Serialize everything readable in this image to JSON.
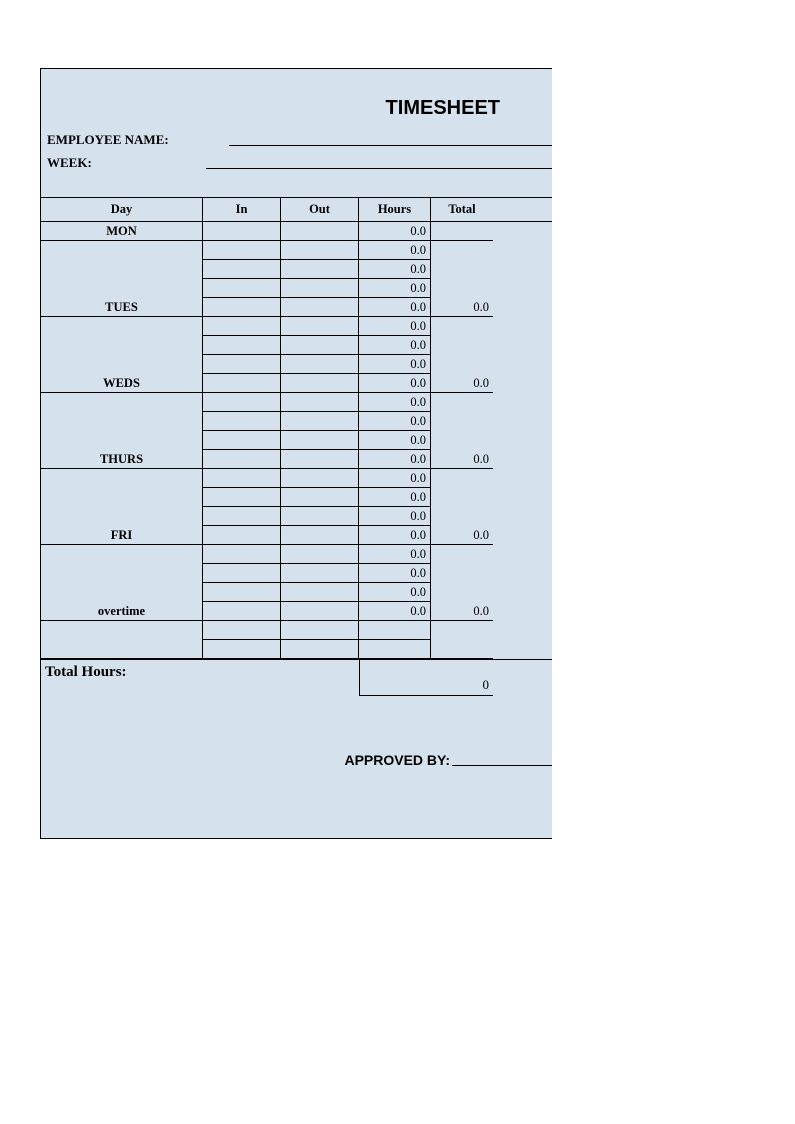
{
  "title": "TIMESHEET",
  "labels": {
    "employee_name": "EMPLOYEE NAME:",
    "week": "WEEK:",
    "approved_by": "APPROVED BY:",
    "total_hours": "Total Hours:"
  },
  "columns": {
    "day": "Day",
    "in": "In",
    "out": "Out",
    "hours": "Hours",
    "total": "Total"
  },
  "rows": [
    {
      "day": "MON",
      "in": "",
      "out": "",
      "hours": "0.0",
      "total": "",
      "day_border": true,
      "block_end": true
    },
    {
      "day": "",
      "in": "",
      "out": "",
      "hours": "0.0",
      "total": "",
      "day_border": false,
      "block_end": false
    },
    {
      "day": "",
      "in": "",
      "out": "",
      "hours": "0.0",
      "total": "",
      "day_border": false,
      "block_end": false
    },
    {
      "day": "",
      "in": "",
      "out": "",
      "hours": "0.0",
      "total": "",
      "day_border": false,
      "block_end": false
    },
    {
      "day": "TUES",
      "in": "",
      "out": "",
      "hours": "0.0",
      "total": "0.0",
      "day_border": true,
      "block_end": true
    },
    {
      "day": "",
      "in": "",
      "out": "",
      "hours": "0.0",
      "total": "",
      "day_border": false,
      "block_end": false
    },
    {
      "day": "",
      "in": "",
      "out": "",
      "hours": "0.0",
      "total": "",
      "day_border": false,
      "block_end": false
    },
    {
      "day": "",
      "in": "",
      "out": "",
      "hours": "0.0",
      "total": "",
      "day_border": false,
      "block_end": false
    },
    {
      "day": "WEDS",
      "in": "",
      "out": "",
      "hours": "0.0",
      "total": "0.0",
      "day_border": true,
      "block_end": true
    },
    {
      "day": "",
      "in": "",
      "out": "",
      "hours": "0.0",
      "total": "",
      "day_border": false,
      "block_end": false
    },
    {
      "day": "",
      "in": "",
      "out": "",
      "hours": "0.0",
      "total": "",
      "day_border": false,
      "block_end": false
    },
    {
      "day": "",
      "in": "",
      "out": "",
      "hours": "0.0",
      "total": "",
      "day_border": false,
      "block_end": false
    },
    {
      "day": "THURS",
      "in": "",
      "out": "",
      "hours": "0.0",
      "total": "0.0",
      "day_border": true,
      "block_end": true
    },
    {
      "day": "",
      "in": "",
      "out": "",
      "hours": "0.0",
      "total": "",
      "day_border": false,
      "block_end": false
    },
    {
      "day": "",
      "in": "",
      "out": "",
      "hours": "0.0",
      "total": "",
      "day_border": false,
      "block_end": false
    },
    {
      "day": "",
      "in": "",
      "out": "",
      "hours": "0.0",
      "total": "",
      "day_border": false,
      "block_end": false
    },
    {
      "day": "FRI",
      "in": "",
      "out": "",
      "hours": "0.0",
      "total": "0.0",
      "day_border": true,
      "block_end": true
    },
    {
      "day": "",
      "in": "",
      "out": "",
      "hours": "0.0",
      "total": "",
      "day_border": false,
      "block_end": false
    },
    {
      "day": "",
      "in": "",
      "out": "",
      "hours": "0.0",
      "total": "",
      "day_border": false,
      "block_end": false
    },
    {
      "day": "",
      "in": "",
      "out": "",
      "hours": "0.0",
      "total": "",
      "day_border": false,
      "block_end": false
    },
    {
      "day": "overtime",
      "in": "",
      "out": "",
      "hours": "0.0",
      "total": "0.0",
      "day_border": true,
      "block_end": true
    },
    {
      "day": "",
      "in": "",
      "out": "",
      "hours": "",
      "total": "",
      "day_border": false,
      "block_end": false,
      "spacer": true
    },
    {
      "day": "",
      "in": "",
      "out": "",
      "hours": "",
      "total": "",
      "day_border": false,
      "block_end": false,
      "spacer": true,
      "spacer_last": true
    }
  ],
  "summary": {
    "total_hours_value": "0"
  }
}
